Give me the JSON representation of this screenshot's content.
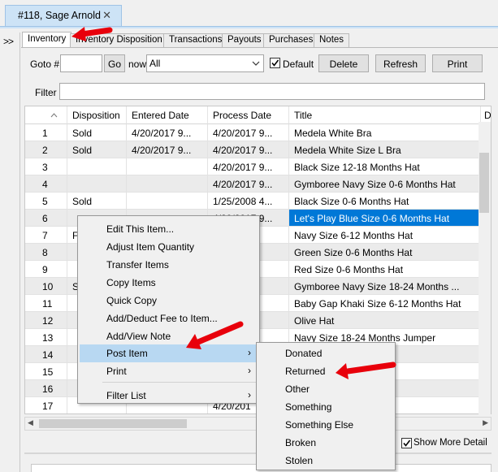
{
  "document_tab": {
    "title": "#118, Sage Arnold",
    "close_glyph": "✕"
  },
  "collapse_glyph": ">>",
  "tabs": [
    "Inventory",
    "Inventory Disposition",
    "Transactions",
    "Payouts",
    "Purchases",
    "Notes"
  ],
  "toolbar": {
    "goto_label": "Goto #",
    "goto_value": "",
    "go_button": "Go",
    "show_label": "now",
    "show_value": "All",
    "default_label": "Default",
    "default_checked": true,
    "delete_button": "Delete",
    "refresh_button": "Refresh",
    "print_button": "Print",
    "filter_label": "Filter",
    "filter_value": ""
  },
  "grid": {
    "columns": [
      "",
      "Disposition",
      "Entered Date",
      "Process Date",
      "Title",
      "D"
    ],
    "rows": [
      {
        "num": "1",
        "disposition": "Sold",
        "entered": "4/20/2017 9...",
        "process": "4/20/2017 9...",
        "title": "Medela White Bra"
      },
      {
        "num": "2",
        "disposition": "Sold",
        "entered": "4/20/2017 9...",
        "process": "4/20/2017 9...",
        "title": "Medela White Size L Bra"
      },
      {
        "num": "3",
        "disposition": "",
        "entered": "",
        "process": "4/20/2017 9...",
        "title": "Black Size 12-18 Months Hat"
      },
      {
        "num": "4",
        "disposition": "",
        "entered": "",
        "process": "4/20/2017 9...",
        "title": "Gymboree Navy Size 0-6 Months Hat"
      },
      {
        "num": "5",
        "disposition": "Sold",
        "entered": "",
        "process": "1/25/2008 4...",
        "title": "Black Size 0-6 Months Hat"
      },
      {
        "num": "6",
        "disposition": "",
        "entered": "",
        "process": "4/20/2017 9...",
        "title": "Let's Play Blue Size 0-6 Months Hat"
      },
      {
        "num": "7",
        "disposition": "F",
        "entered": "",
        "process": "7 9...",
        "title": "Navy Size 6-12 Months Hat"
      },
      {
        "num": "8",
        "disposition": "",
        "entered": "",
        "process": "7 9...",
        "title": "Green Size 0-6 Months Hat"
      },
      {
        "num": "9",
        "disposition": "",
        "entered": "",
        "process": "7 9...",
        "title": "Red Size 0-6 Months Hat"
      },
      {
        "num": "10",
        "disposition": "S",
        "entered": "",
        "process": "7 9...",
        "title": "Gymboree Navy Size 18-24 Months ..."
      },
      {
        "num": "11",
        "disposition": "",
        "entered": "",
        "process": "7 9...",
        "title": "Baby Gap Khaki Size 6-12 Months Hat"
      },
      {
        "num": "12",
        "disposition": "",
        "entered": "",
        "process": "7 9...",
        "title": "Olive Hat"
      },
      {
        "num": "13",
        "disposition": "",
        "entered": "",
        "process": "7 9...",
        "title": "Navy Size 18-24 Months Jumper"
      },
      {
        "num": "14",
        "disposition": "",
        "entered": "",
        "process": "",
        "title": "4 Months Hawa..."
      },
      {
        "num": "15",
        "disposition": "",
        "entered": "",
        "process": "",
        "title": "Months Hawaiian S..."
      },
      {
        "num": "16",
        "disposition": "",
        "entered": "",
        "process": "",
        "title": "live Size 6-12 ..."
      },
      {
        "num": "17",
        "disposition": "",
        "entered": "",
        "process": "4/20/201",
        "title": "4 Months Strip..."
      }
    ],
    "selected_row": 6
  },
  "context_menu": {
    "items": [
      "Edit This Item...",
      "Adjust Item Quantity",
      "Transfer Items",
      "Copy Items",
      "Quick Copy",
      "Add/Deduct Fee to Item...",
      "Add/View Note",
      "Post Item",
      "Print",
      "Filter List"
    ],
    "highlighted": "Post Item",
    "submenu_glyph": "›"
  },
  "submenu": {
    "items": [
      "Donated",
      "Returned",
      "Other",
      "Something",
      "Something Else",
      "Broken",
      "Stolen"
    ]
  },
  "footer": {
    "show_more_label": "Show More Detail",
    "show_more_checked": true
  },
  "colors": {
    "selection": "#0078d7",
    "annotation_arrow": "#e8000b",
    "tab_highlight": "#cde3f6"
  }
}
